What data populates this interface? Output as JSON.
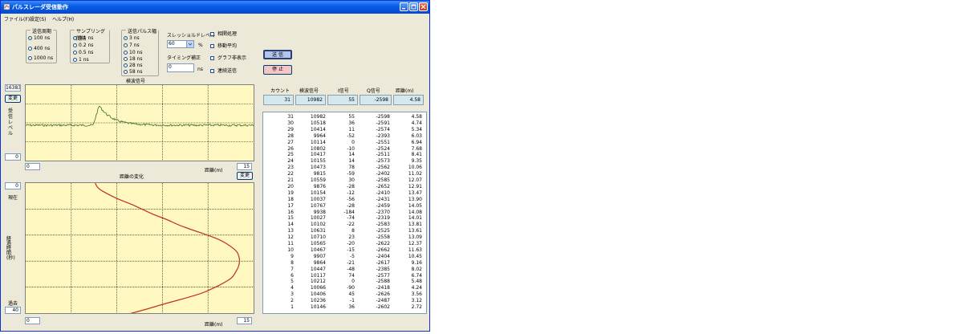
{
  "window": {
    "title": "パルスレーダ受信動作"
  },
  "menu": [
    "ファイル(F)",
    "設定(S)",
    "ヘルプ(H)"
  ],
  "groups": {
    "period": {
      "label": "送信周期",
      "options": [
        "100 ns",
        "400 ns",
        "1000 ns"
      ],
      "selected": 0
    },
    "sampling": {
      "label": "サンプリング間隔",
      "options": [
        "0.1 ns",
        "0.2 ns",
        "0.5 ns",
        "1 ns"
      ],
      "selected": 0
    },
    "pulse": {
      "label": "送信パルス幅",
      "options": [
        "3 ns",
        "7 ns",
        "10 ns",
        "18 ns",
        "28 ns",
        "58 ns"
      ],
      "selected": 0
    }
  },
  "threshold": {
    "label": "スレッショルドレベル",
    "value": "60",
    "unit": "%"
  },
  "timing": {
    "label": "タイミング補正",
    "value": "0",
    "unit": "ns"
  },
  "checks": [
    "相関処理",
    "移動平均",
    "グラフ非表示",
    "連続送信"
  ],
  "buttons": {
    "send": "送 信",
    "stop": "停 止"
  },
  "chart1": {
    "title": "検波信号",
    "ymax": "16383",
    "change": "変更",
    "ylabel": "受\n信\nレ\nベ\nル",
    "ymin": "0",
    "xmin": "0",
    "xmax_label": "距離(m)",
    "xmax": "15",
    "change2": "変更"
  },
  "chart2": {
    "title": "距離の変化",
    "ytop": "0",
    "now": "現在",
    "ylabel": "経\n過\n時\n間\n(秒)",
    "past": "過去",
    "ybottom": "40",
    "xmin": "0",
    "xmax_label": "距離(m)",
    "xmax": "15"
  },
  "table": {
    "headers": [
      "カウント",
      "検波信号",
      "I信号",
      "Q信号",
      "距離(m)"
    ],
    "summary": [
      "31",
      "10982",
      "55",
      "-2598",
      "4.58"
    ],
    "rows": [
      [
        "31",
        "10982",
        "55",
        "-2598",
        "4.58"
      ],
      [
        "30",
        "10518",
        "36",
        "-2591",
        "4.74"
      ],
      [
        "29",
        "10414",
        "11",
        "-2574",
        "5.34"
      ],
      [
        "28",
        "9964",
        "-52",
        "-2393",
        "6.03"
      ],
      [
        "27",
        "10114",
        "0",
        "-2551",
        "6.94"
      ],
      [
        "26",
        "10802",
        "-10",
        "-2524",
        "7.68"
      ],
      [
        "25",
        "10417",
        "14",
        "-2511",
        "8.41"
      ],
      [
        "24",
        "10155",
        "14",
        "-2573",
        "9.35"
      ],
      [
        "23",
        "10473",
        "78",
        "-2562",
        "10.06"
      ],
      [
        "22",
        "9815",
        "-59",
        "-2402",
        "11.02"
      ],
      [
        "21",
        "10559",
        "30",
        "-2585",
        "12.07"
      ],
      [
        "20",
        "9876",
        "-28",
        "-2652",
        "12.91"
      ],
      [
        "19",
        "10154",
        "-12",
        "-2410",
        "13.47"
      ],
      [
        "18",
        "10037",
        "-56",
        "-2431",
        "13.90"
      ],
      [
        "17",
        "10767",
        "-28",
        "-2459",
        "14.05"
      ],
      [
        "16",
        "9938",
        "-184",
        "-2370",
        "14.08"
      ],
      [
        "15",
        "10027",
        "-74",
        "-2319",
        "14.01"
      ],
      [
        "14",
        "10102",
        "-22",
        "-2583",
        "13.81"
      ],
      [
        "13",
        "10631",
        "8",
        "-2525",
        "13.61"
      ],
      [
        "12",
        "10710",
        "23",
        "-2558",
        "13.09"
      ],
      [
        "11",
        "10565",
        "-20",
        "-2622",
        "12.37"
      ],
      [
        "10",
        "10467",
        "-15",
        "-2662",
        "11.63"
      ],
      [
        "9",
        "9907",
        "-5",
        "-2404",
        "10.45"
      ],
      [
        "8",
        "9864",
        "-21",
        "-2617",
        "9.16"
      ],
      [
        "7",
        "10447",
        "-48",
        "-2385",
        "8.02"
      ],
      [
        "6",
        "10117",
        "74",
        "-2577",
        "6.74"
      ],
      [
        "5",
        "10212",
        "0",
        "-2588",
        "5.48"
      ],
      [
        "4",
        "10066",
        "-90",
        "-2418",
        "4.24"
      ],
      [
        "3",
        "10406",
        "45",
        "-2626",
        "3.56"
      ],
      [
        "2",
        "10236",
        "-1",
        "-2487",
        "3.12"
      ],
      [
        "1",
        "10146",
        "36",
        "-2602",
        "2.72"
      ]
    ]
  },
  "colors": {
    "chart_bg": "#fff8c0",
    "signal_line": "#3a6b2a",
    "distance_curve": "#c03020",
    "send_button": "#b0c4ee",
    "stop_button": "#f5c6c6"
  }
}
